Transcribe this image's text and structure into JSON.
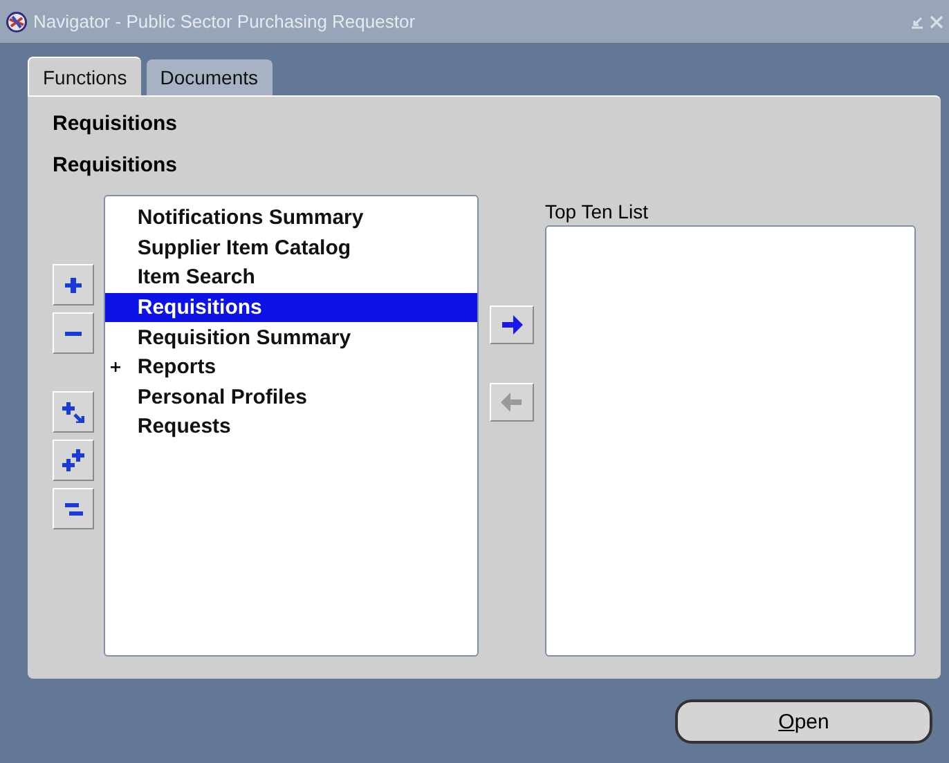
{
  "window": {
    "title": "Navigator - Public Sector Purchasing Requestor"
  },
  "tabs": [
    {
      "label": "Functions",
      "selected": true
    },
    {
      "label": "Documents",
      "selected": false
    }
  ],
  "headings": [
    "Requisitions",
    "Requisitions"
  ],
  "side_buttons": [
    {
      "kind": "expand"
    },
    {
      "kind": "collapse"
    },
    {
      "kind": "expand-branch"
    },
    {
      "kind": "expand-all"
    },
    {
      "kind": "collapse-all"
    }
  ],
  "functions_list": [
    {
      "label": "Notifications Summary",
      "selected": false
    },
    {
      "label": "Supplier Item Catalog",
      "selected": false
    },
    {
      "label": "Item Search",
      "selected": false
    },
    {
      "label": "Requisitions",
      "selected": true
    },
    {
      "label": "Requisition Summary",
      "selected": false
    },
    {
      "label": "Reports",
      "selected": false,
      "expanded": false
    },
    {
      "label": "Personal Profiles",
      "selected": false
    },
    {
      "label": "Requests",
      "selected": false
    }
  ],
  "move_buttons": [
    {
      "kind": "add",
      "disabled": false
    },
    {
      "kind": "remove",
      "disabled": true
    }
  ],
  "top_ten": {
    "label": "Top Ten List"
  },
  "open_button": {
    "label": "Open"
  }
}
